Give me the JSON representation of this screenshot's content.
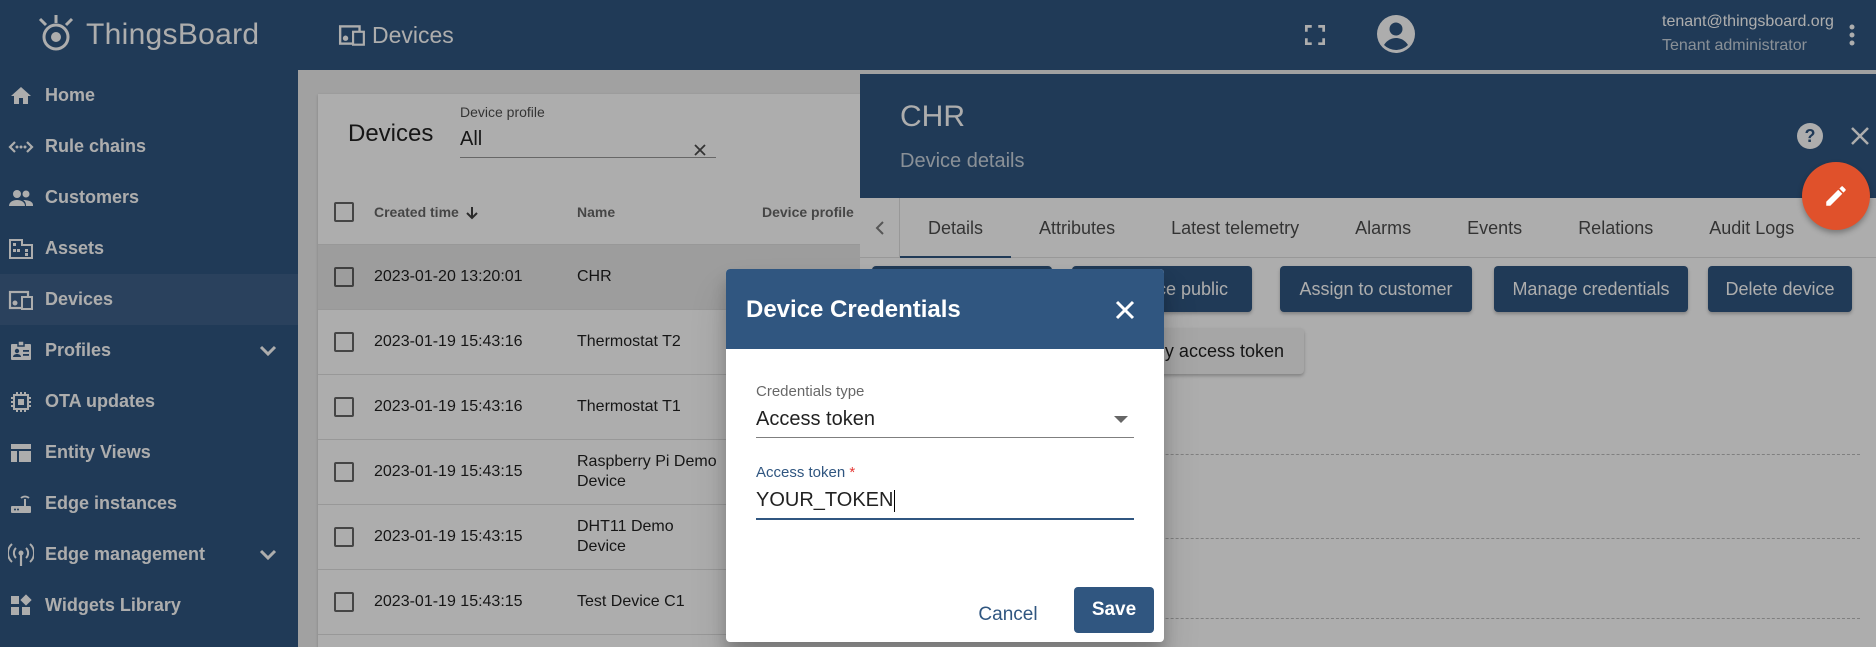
{
  "app": {
    "name": "ThingsBoard"
  },
  "sidebar": {
    "items": [
      {
        "label": "Home",
        "icon": "home-icon"
      },
      {
        "label": "Rule chains",
        "icon": "rule-chains-icon"
      },
      {
        "label": "Customers",
        "icon": "customers-icon"
      },
      {
        "label": "Assets",
        "icon": "assets-icon"
      },
      {
        "label": "Devices",
        "icon": "devices-icon",
        "active": true
      },
      {
        "label": "Profiles",
        "icon": "profiles-icon",
        "expandable": true
      },
      {
        "label": "OTA updates",
        "icon": "ota-icon"
      },
      {
        "label": "Entity Views",
        "icon": "entity-views-icon"
      },
      {
        "label": "Edge instances",
        "icon": "router-icon"
      },
      {
        "label": "Edge management",
        "icon": "edge-management-icon",
        "expandable": true
      },
      {
        "label": "Widgets Library",
        "icon": "widgets-icon"
      }
    ]
  },
  "header": {
    "title": "Devices",
    "user_email": "tenant@thingsboard.org",
    "user_role": "Tenant administrator"
  },
  "devices_list": {
    "title": "Devices",
    "filter_label": "Device profile",
    "filter_value": "All",
    "columns": [
      "Created time",
      "Name",
      "Device profile"
    ],
    "rows": [
      {
        "created": "2023-01-20 13:20:01",
        "name": "CHR",
        "selected": true
      },
      {
        "created": "2023-01-19 15:43:16",
        "name": "Thermostat T2"
      },
      {
        "created": "2023-01-19 15:43:16",
        "name": "Thermostat T1"
      },
      {
        "created": "2023-01-19 15:43:15",
        "name": "Raspberry Pi Demo Device"
      },
      {
        "created": "2023-01-19 15:43:15",
        "name": "DHT11 Demo Device"
      },
      {
        "created": "2023-01-19 15:43:15",
        "name": "Test Device C1"
      }
    ]
  },
  "detail": {
    "title": "CHR",
    "subtitle": "Device details",
    "tabs": [
      "Details",
      "Attributes",
      "Latest telemetry",
      "Alarms",
      "Events",
      "Relations",
      "Audit Logs"
    ],
    "active_tab": "Details",
    "buttons": {
      "make_public": "vice public",
      "assign": "Assign to customer",
      "manage": "Manage credentials",
      "delete": "Delete device",
      "copy_token": "py access token"
    }
  },
  "dialog": {
    "title": "Device Credentials",
    "credentials_type_label": "Credentials type",
    "credentials_type_value": "Access token",
    "access_token_label": "Access token",
    "required_mark": "*",
    "access_token_value": "YOUR_TOKEN",
    "cancel_label": "Cancel",
    "save_label": "Save"
  },
  "colors": {
    "primary": "#305680",
    "fab": "#e0512b"
  }
}
